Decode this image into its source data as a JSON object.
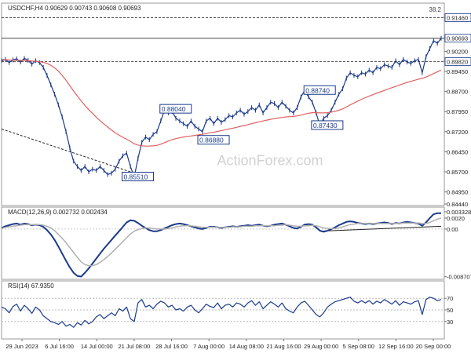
{
  "chart_data": [
    {
      "type": "line",
      "panel": "price",
      "header": "USDCHF,H4  0.90629 0.90743 0.90608 0.90693",
      "watermark": "ActionForex.com",
      "ylim": [
        0.8444,
        0.92
      ],
      "yticks": [
        0.9146,
        0.9069,
        0.902,
        0.8982,
        0.8945,
        0.887,
        0.8795,
        0.872,
        0.8645,
        0.857,
        0.8495,
        0.8444
      ],
      "ytick_labels": [
        "0.91460",
        "0.90693",
        "0.90200",
        "0.89820",
        "0.89450",
        "0.88700",
        "0.87950",
        "0.87200",
        "0.86450",
        "0.85700",
        "0.84950",
        "0.84440"
      ],
      "highlighted_ticks": [
        "0.91460",
        "0.90693",
        "0.89820"
      ],
      "fib_label": "38.2",
      "horizontal_lines": [
        {
          "value": 0.9146,
          "style": "dashed"
        },
        {
          "value": 0.9069,
          "style": "solid"
        },
        {
          "value": 0.8982,
          "style": "dashed"
        }
      ],
      "trendline": {
        "from": [
          0,
          0.873
        ],
        "to": [
          34,
          0.857
        ],
        "style": "dashed"
      },
      "annotations": [
        {
          "text": "0.88040",
          "x": 42,
          "y": 0.8804
        },
        {
          "text": "0.86880",
          "x": 52,
          "y": 0.8688
        },
        {
          "text": "0.85510",
          "x": 32,
          "y": 0.8551
        },
        {
          "text": "0.88740",
          "x": 80,
          "y": 0.8874
        },
        {
          "text": "0.87430",
          "x": 82,
          "y": 0.8743
        }
      ],
      "series": [
        {
          "name": "",
          "role": "price",
          "color": "#1a3a8a",
          "values": [
            0.8985,
            0.899,
            0.8978,
            0.8988,
            0.8992,
            0.898,
            0.8994,
            0.8986,
            0.8972,
            0.8985,
            0.8978,
            0.896,
            0.893,
            0.8895,
            0.886,
            0.882,
            0.8775,
            0.872,
            0.866,
            0.861,
            0.859,
            0.8575,
            0.859,
            0.857,
            0.858,
            0.8575,
            0.859,
            0.8575,
            0.856,
            0.8565,
            0.858,
            0.861,
            0.863,
            0.864,
            0.859,
            0.8551,
            0.862,
            0.868,
            0.87,
            0.869,
            0.871,
            0.872,
            0.876,
            0.88,
            0.879,
            0.8795,
            0.877,
            0.876,
            0.875,
            0.874,
            0.876,
            0.874,
            0.873,
            0.872,
            0.876,
            0.877,
            0.875,
            0.877,
            0.8755,
            0.8765,
            0.878,
            0.8775,
            0.879,
            0.88,
            0.8785,
            0.8795,
            0.881,
            0.88,
            0.882,
            0.879,
            0.881,
            0.883,
            0.8825,
            0.881,
            0.883,
            0.8815,
            0.88,
            0.879,
            0.881,
            0.885,
            0.8874,
            0.885,
            0.883,
            0.879,
            0.8743,
            0.877,
            0.878,
            0.88,
            0.883,
            0.886,
            0.888,
            0.892,
            0.894,
            0.893,
            0.8925,
            0.894,
            0.8935,
            0.895,
            0.894,
            0.896,
            0.8955,
            0.897,
            0.8965,
            0.896,
            0.8985,
            0.897,
            0.899,
            0.898,
            0.8975,
            0.8985,
            0.899,
            0.894,
            0.9,
            0.903,
            0.906,
            0.905,
            0.9069
          ]
        },
        {
          "name": "",
          "role": "moving-average",
          "color": "#e06060",
          "values": [
            0.899,
            0.8989,
            0.8988,
            0.8987,
            0.8987,
            0.8986,
            0.8986,
            0.8985,
            0.8984,
            0.8983,
            0.8981,
            0.8979,
            0.8975,
            0.8968,
            0.8958,
            0.8946,
            0.893,
            0.8912,
            0.8892,
            0.8872,
            0.8853,
            0.8835,
            0.8818,
            0.8802,
            0.8788,
            0.8774,
            0.8761,
            0.8749,
            0.8737,
            0.8726,
            0.8716,
            0.8707,
            0.8699,
            0.8692,
            0.8684,
            0.8675,
            0.867,
            0.8667,
            0.8666,
            0.8666,
            0.8667,
            0.8669,
            0.8673,
            0.8679,
            0.8685,
            0.869,
            0.8694,
            0.8697,
            0.87,
            0.8702,
            0.8704,
            0.8706,
            0.8708,
            0.871,
            0.8713,
            0.8716,
            0.8718,
            0.8721,
            0.8724,
            0.8727,
            0.873,
            0.8733,
            0.8736,
            0.874,
            0.8743,
            0.8746,
            0.875,
            0.8753,
            0.8757,
            0.876,
            0.8763,
            0.8766,
            0.8769,
            0.8771,
            0.8773,
            0.8775,
            0.8776,
            0.8777,
            0.8779,
            0.8782,
            0.8786,
            0.8789,
            0.8791,
            0.8791,
            0.879,
            0.879,
            0.8791,
            0.8793,
            0.8796,
            0.88,
            0.8805,
            0.8812,
            0.882,
            0.8827,
            0.8834,
            0.8841,
            0.8847,
            0.8853,
            0.8858,
            0.8864,
            0.8869,
            0.8874,
            0.8879,
            0.8884,
            0.8889,
            0.8894,
            0.8899,
            0.8904,
            0.8908,
            0.8912,
            0.8916,
            0.8919,
            0.8924,
            0.893,
            0.8937,
            0.8944,
            0.895
          ]
        }
      ]
    },
    {
      "type": "line",
      "panel": "macd",
      "header": "MACD(12,26,9) 0.002732 0.002434",
      "ylim": [
        -0.0092,
        0.004
      ],
      "yticks": [
        0.003328,
        0.002,
        0.0,
        -0.008707
      ],
      "ytick_labels": [
        "0.003328",
        "0.0020",
        "0.00",
        "-0.008707"
      ],
      "trendline": {
        "from": [
          84,
          -0.0004
        ],
        "to": [
          116,
          0.0005
        ],
        "style": "solid"
      },
      "series": [
        {
          "name": "",
          "role": "macd",
          "color": "#1a3a8a",
          "values": [
            0.0002,
            0.0005,
            0.0007,
            0.0009,
            0.001,
            0.0008,
            0.001,
            0.0009,
            0.0007,
            0.0008,
            0.0007,
            0.0004,
            -0.0002,
            -0.001,
            -0.002,
            -0.0032,
            -0.0045,
            -0.0058,
            -0.007,
            -0.008,
            -0.0086,
            -0.0087,
            -0.008,
            -0.0072,
            -0.0063,
            -0.0054,
            -0.0045,
            -0.0036,
            -0.0028,
            -0.002,
            -0.0012,
            -0.0004,
            0.0004,
            0.0012,
            0.0016,
            0.0015,
            0.0011,
            0.0006,
            0.0002,
            -0.0002,
            -0.0004,
            -0.0004,
            -0.0002,
            0.0001,
            0.0004,
            0.0007,
            0.0009,
            0.001,
            0.0009,
            0.0007,
            0.0005,
            0.0003,
            0.0001,
            0.0,
            0.0002,
            0.0004,
            0.0004,
            0.0003,
            0.0002,
            0.0003,
            0.0004,
            0.0005,
            0.0004,
            0.0005,
            0.0006,
            0.0007,
            0.0006,
            0.0007,
            0.0008,
            0.0006,
            0.0005,
            0.0006,
            0.0008,
            0.0009,
            0.001,
            0.0008,
            0.0005,
            0.0002,
            0.0001,
            0.0004,
            0.0008,
            0.0009,
            0.0008,
            0.0003,
            -0.0003,
            -0.0005,
            -0.0003,
            0.0,
            0.0003,
            0.0007,
            0.001,
            0.0013,
            0.0014,
            0.0013,
            0.0011,
            0.001,
            0.0009,
            0.001,
            0.0009,
            0.001,
            0.0011,
            0.0012,
            0.0011,
            0.0009,
            0.0011,
            0.001,
            0.0012,
            0.0013,
            0.0012,
            0.0011,
            0.001,
            0.0006,
            0.0012,
            0.002,
            0.0027,
            0.0029,
            0.0029
          ]
        },
        {
          "name": "",
          "role": "signal",
          "color": "#b0b0b0",
          "values": [
            0.0001,
            0.0003,
            0.0004,
            0.0005,
            0.0006,
            0.0007,
            0.0008,
            0.0008,
            0.0008,
            0.0008,
            0.0008,
            0.0007,
            0.0005,
            0.0002,
            -0.0003,
            -0.001,
            -0.0017,
            -0.0025,
            -0.0034,
            -0.0043,
            -0.0052,
            -0.006,
            -0.0065,
            -0.0067,
            -0.0067,
            -0.0065,
            -0.0061,
            -0.0056,
            -0.005,
            -0.0044,
            -0.0037,
            -0.003,
            -0.0023,
            -0.0016,
            -0.0009,
            -0.0004,
            -0.0001,
            0.0001,
            0.0002,
            0.0002,
            0.0001,
            0.0,
            0.0,
            0.0,
            0.0001,
            0.0002,
            0.0004,
            0.0005,
            0.0006,
            0.0006,
            0.0006,
            0.0005,
            0.0004,
            0.0003,
            0.0003,
            0.0003,
            0.0003,
            0.0003,
            0.0003,
            0.0003,
            0.0003,
            0.0004,
            0.0004,
            0.0004,
            0.0005,
            0.0005,
            0.0005,
            0.0006,
            0.0006,
            0.0006,
            0.0006,
            0.0006,
            0.0006,
            0.0007,
            0.0007,
            0.0008,
            0.0007,
            0.0006,
            0.0005,
            0.0005,
            0.0006,
            0.0006,
            0.0007,
            0.0006,
            0.0004,
            0.0002,
            0.0001,
            0.0001,
            0.0001,
            0.0002,
            0.0004,
            0.0006,
            0.0008,
            0.0009,
            0.001,
            0.001,
            0.001,
            0.001,
            0.001,
            0.001,
            0.001,
            0.001,
            0.001,
            0.001,
            0.001,
            0.001,
            0.0011,
            0.0011,
            0.0011,
            0.0011,
            0.0011,
            0.001,
            0.001,
            0.0012,
            0.0015,
            0.0018,
            0.002
          ]
        }
      ]
    },
    {
      "type": "line",
      "panel": "rsi",
      "header": "RSI(14) 67.9350",
      "ylim": [
        0,
        100
      ],
      "yticks": [
        70,
        50,
        30
      ],
      "ytick_labels": [
        "70",
        "50",
        "30"
      ],
      "levels": [
        70,
        50,
        30
      ],
      "series": [
        {
          "name": "",
          "role": "rsi",
          "color": "#1a3a8a",
          "values": [
            55,
            52,
            45,
            56,
            60,
            48,
            58,
            52,
            44,
            55,
            50,
            40,
            35,
            30,
            28,
            25,
            30,
            22,
            25,
            20,
            28,
            24,
            32,
            26,
            30,
            38,
            42,
            35,
            40,
            45,
            40,
            52,
            48,
            55,
            35,
            30,
            62,
            68,
            55,
            58,
            52,
            60,
            65,
            62,
            55,
            58,
            50,
            52,
            48,
            55,
            58,
            50,
            45,
            52,
            60,
            56,
            54,
            62,
            52,
            58,
            60,
            55,
            62,
            60,
            55,
            62,
            66,
            58,
            64,
            52,
            58,
            64,
            60,
            55,
            62,
            52,
            48,
            45,
            55,
            62,
            65,
            58,
            50,
            42,
            38,
            45,
            55,
            60,
            64,
            66,
            68,
            70,
            72,
            65,
            62,
            66,
            62,
            66,
            60,
            65,
            62,
            68,
            64,
            60,
            66,
            58,
            64,
            62,
            60,
            64,
            66,
            42,
            68,
            72,
            70,
            66,
            68
          ]
        }
      ],
      "x_tick_labels": [
        "29 Jun 2023",
        "6 Jul 16:00",
        "14 Jul 00:00",
        "21 Jul 08:00",
        "28 Jul 16:00",
        "7 Aug 00:00",
        "14 Aug 08:00",
        "21 Aug 16:00",
        "29 Aug 00:00",
        "5 Sep 08:00",
        "12 Sep 16:00",
        "20 Sep 00:00"
      ]
    }
  ]
}
